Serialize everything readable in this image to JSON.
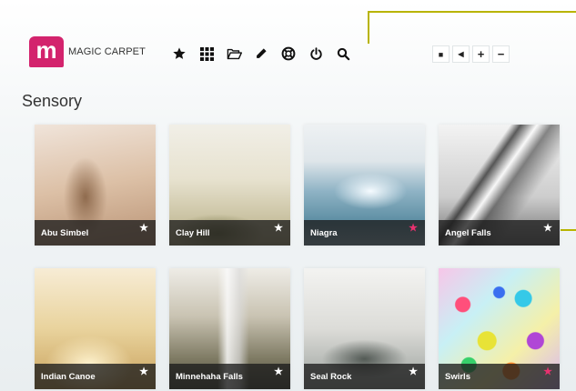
{
  "app": {
    "logo_letter": "m",
    "name": "MAGIC CARPET",
    "brand_color": "#d3236d",
    "callout_color": "#b8b400"
  },
  "toolbar": {
    "icons": [
      "star-icon",
      "grid-icon",
      "folder-icon",
      "pencil-icon",
      "lifebuoy-icon",
      "power-icon",
      "search-icon"
    ]
  },
  "controls": {
    "buttons": [
      {
        "icon": "stop-icon",
        "glyph": "■"
      },
      {
        "icon": "megaphone-icon",
        "glyph": "◀"
      },
      {
        "icon": "plus-icon",
        "glyph": "+"
      },
      {
        "icon": "minus-icon",
        "glyph": "−"
      }
    ]
  },
  "section": {
    "title": "Sensory"
  },
  "tiles": [
    {
      "label": "Abu Simbel",
      "favorite": false,
      "star": "★"
    },
    {
      "label": "Clay Hill",
      "favorite": false,
      "star": "★"
    },
    {
      "label": "Niagra",
      "favorite": true,
      "star": "★"
    },
    {
      "label": "Angel Falls",
      "favorite": false,
      "star": "★"
    },
    {
      "label": "Indian Canoe",
      "favorite": false,
      "star": "★"
    },
    {
      "label": "Minnehaha Falls",
      "favorite": false,
      "star": "★"
    },
    {
      "label": "Seal Rock",
      "favorite": false,
      "star": "★"
    },
    {
      "label": "Swirls",
      "favorite": true,
      "star": "★"
    }
  ],
  "colors": {
    "star_default": "#ffffff",
    "star_favorite": "#e8316f"
  }
}
